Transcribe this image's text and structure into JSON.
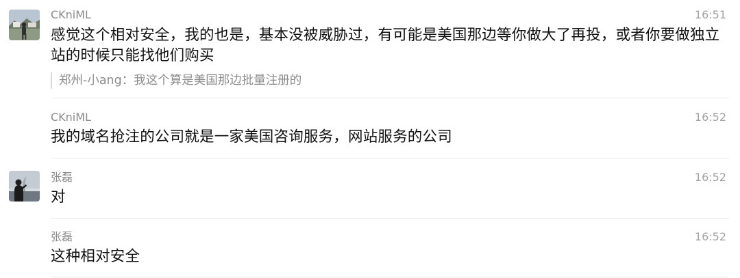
{
  "messages": [
    {
      "sender": "CKniML",
      "time": "16:51",
      "text": "感觉这个相对安全，我的也是，基本没被威胁过，有可能是美国那边等你做大了再投，或者你要做独立站的时候只能找他们购买",
      "quote": "郑州-小ang：我这个算是美国那边批量注册的",
      "avatar": "landscape-avatar"
    },
    {
      "sender": "CKniML",
      "time": "16:52",
      "text": "我的域名抢注的公司就是一家美国咨询服务，网站服务的公司"
    },
    {
      "sender": "张磊",
      "time": "16:52",
      "text": "对",
      "avatar": "silhouette-avatar"
    },
    {
      "sender": "张磊",
      "time": "16:52",
      "text": "这种相对安全"
    }
  ]
}
